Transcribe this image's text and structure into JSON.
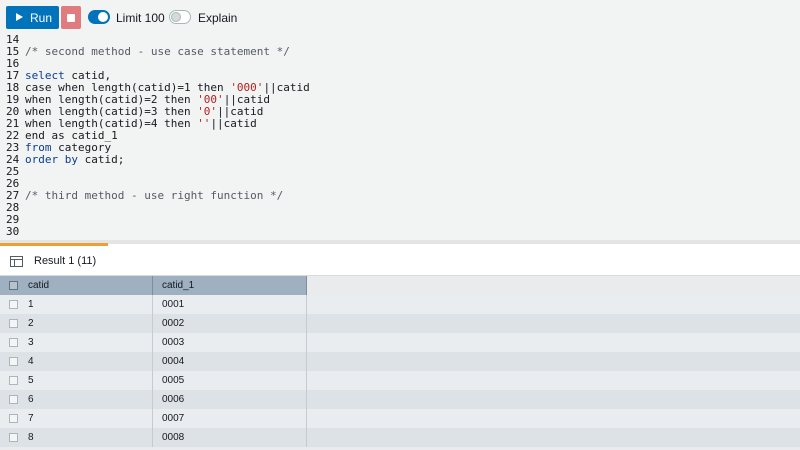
{
  "toolbar": {
    "run_label": "Run",
    "limit_label": "Limit 100",
    "limit_enabled": true,
    "explain_label": "Explain",
    "explain_enabled": false
  },
  "editor": {
    "lines": [
      {
        "num": "14",
        "tokens": []
      },
      {
        "num": "15",
        "tokens": [
          {
            "t": "/* second method - use case statement */",
            "c": "comment"
          }
        ]
      },
      {
        "num": "16",
        "tokens": []
      },
      {
        "num": "17",
        "tokens": [
          {
            "t": "select",
            "c": "kw"
          },
          {
            "t": " catid,",
            "c": "plain"
          }
        ]
      },
      {
        "num": "18",
        "tokens": [
          {
            "t": "case when length(catid)=1 then ",
            "c": "plain"
          },
          {
            "t": "'000'",
            "c": "str"
          },
          {
            "t": "||catid",
            "c": "plain"
          }
        ]
      },
      {
        "num": "19",
        "tokens": [
          {
            "t": "when length(catid)=2 then ",
            "c": "plain"
          },
          {
            "t": "'00'",
            "c": "str"
          },
          {
            "t": "||catid",
            "c": "plain"
          }
        ]
      },
      {
        "num": "20",
        "tokens": [
          {
            "t": "when length(catid)=3 then ",
            "c": "plain"
          },
          {
            "t": "'0'",
            "c": "str"
          },
          {
            "t": "||catid",
            "c": "plain"
          }
        ]
      },
      {
        "num": "21",
        "tokens": [
          {
            "t": "when length(catid)=4 then ",
            "c": "plain"
          },
          {
            "t": "''",
            "c": "str"
          },
          {
            "t": "||catid",
            "c": "plain"
          }
        ]
      },
      {
        "num": "22",
        "tokens": [
          {
            "t": "end as catid_1",
            "c": "plain"
          }
        ]
      },
      {
        "num": "23",
        "tokens": [
          {
            "t": "from",
            "c": "kw"
          },
          {
            "t": " category",
            "c": "plain"
          }
        ]
      },
      {
        "num": "24",
        "tokens": [
          {
            "t": "order by",
            "c": "kw"
          },
          {
            "t": " catid;",
            "c": "plain"
          }
        ]
      },
      {
        "num": "25",
        "tokens": []
      },
      {
        "num": "26",
        "tokens": []
      },
      {
        "num": "27",
        "tokens": [
          {
            "t": "/* third method - use right function */",
            "c": "comment"
          }
        ]
      },
      {
        "num": "28",
        "tokens": []
      },
      {
        "num": "29",
        "tokens": []
      },
      {
        "num": "30",
        "tokens": []
      }
    ]
  },
  "results": {
    "tab_label": "Result 1 (11)",
    "columns": [
      "catid",
      "catid_1"
    ],
    "rows": [
      [
        "1",
        "0001"
      ],
      [
        "2",
        "0002"
      ],
      [
        "3",
        "0003"
      ],
      [
        "4",
        "0004"
      ],
      [
        "5",
        "0005"
      ],
      [
        "6",
        "0006"
      ],
      [
        "7",
        "0007"
      ],
      [
        "8",
        "0008"
      ]
    ]
  }
}
